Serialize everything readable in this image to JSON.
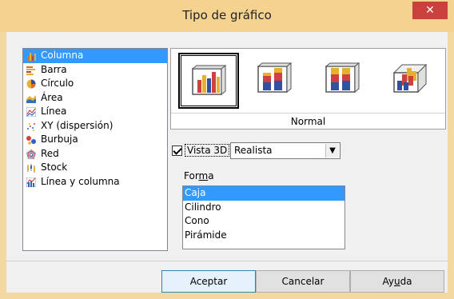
{
  "window": {
    "title": "Tipo de gráfico",
    "close_glyph": "✕"
  },
  "chart_types": [
    {
      "label": "Columna",
      "icon": "column-chart-icon",
      "selected": true
    },
    {
      "label": "Barra",
      "icon": "bar-chart-icon"
    },
    {
      "label": "Círculo",
      "icon": "pie-chart-icon"
    },
    {
      "label": "Área",
      "icon": "area-chart-icon"
    },
    {
      "label": "Línea",
      "icon": "line-chart-icon"
    },
    {
      "label": "XY (dispersión)",
      "icon": "scatter-chart-icon"
    },
    {
      "label": "Burbuja",
      "icon": "bubble-chart-icon"
    },
    {
      "label": "Red",
      "icon": "net-chart-icon"
    },
    {
      "label": "Stock",
      "icon": "stock-chart-icon"
    },
    {
      "label": "Línea y columna",
      "icon": "line-column-chart-icon"
    }
  ],
  "variants": {
    "selected_label": "Normal",
    "items": [
      "normal",
      "stacked",
      "percent-stacked",
      "deep"
    ]
  },
  "options": {
    "vista3d_label": "Vista 3D",
    "vista3d_checked": true,
    "scheme_value": "Realista",
    "forma_label_before": "For",
    "forma_label_accesskey": "m",
    "forma_label_after": "a",
    "shapes": [
      {
        "label": "Caja",
        "selected": true
      },
      {
        "label": "Cilindro"
      },
      {
        "label": "Cono"
      },
      {
        "label": "Pirámide"
      }
    ]
  },
  "buttons": {
    "ok": "Aceptar",
    "cancel": "Cancelar",
    "help_before": "Ay",
    "help_accesskey": "u",
    "help_after": "da"
  },
  "colors": {
    "titlebar": "#f4d28f",
    "selection": "#3399ff",
    "close": "#c9413c"
  }
}
